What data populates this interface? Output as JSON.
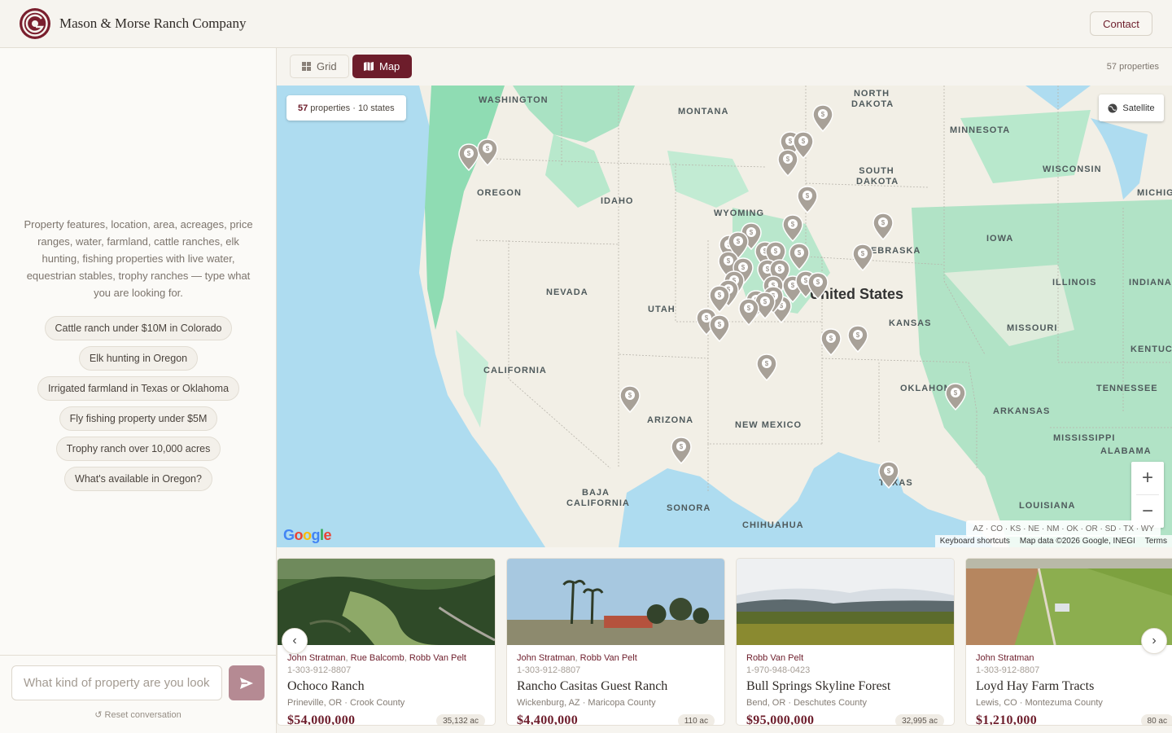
{
  "header": {
    "brand": "Mason & Morse Ranch Company",
    "contact_label": "Contact"
  },
  "sidebar": {
    "intro": "Property features, location, area, acreages, price ranges, water, farmland, cattle ranches, elk hunting, fishing properties with live water, equestrian stables, trophy ranches — type what you are looking for.",
    "suggestions": [
      "Cattle ranch under $10M in Colorado",
      "Elk hunting in Oregon",
      "Irrigated farmland in Texas or Oklahoma",
      "Fly fishing property under $5M",
      "Trophy ranch over 10,000 acres",
      "What's available in Oregon?"
    ],
    "chat_placeholder": "What kind of property are you looking for?",
    "reset_label": "↺ Reset conversation"
  },
  "toolbar": {
    "grid_label": "Grid",
    "map_label": "Map",
    "property_count": "57 properties"
  },
  "map": {
    "summary_count": "57",
    "summary_rest": "properties · 10 states",
    "satellite_label": "Satellite",
    "states_filter": "AZ · CO · KS · NE · NM · OK · OR · SD · TX · WY",
    "keyboard_shortcuts": "Keyboard shortcuts",
    "map_data": "Map data ©2026 Google, INEGI",
    "terms": "Terms",
    "google": "Google",
    "country_label": "United States",
    "state_labels": [
      "WASHINGTON",
      "MONTANA",
      "NORTH DAKOTA",
      "MINNESOTA",
      "OREGON",
      "IDAHO",
      "SOUTH DAKOTA",
      "WISCONSIN",
      "MICHIG",
      "WYOMING",
      "NEBRASKA",
      "IOWA",
      "NEVADA",
      "UTAH",
      "ILLINOIS",
      "INDIANA",
      "KANSAS",
      "MISSOURI",
      "KENTUCK",
      "CALIFORNIA",
      "OKLAHOMA",
      "TENNESSEE",
      "ARKANSAS",
      "ARIZONA",
      "NEW MEXICO",
      "MISSISSIPPI",
      "ALABAMA",
      "BAJA CALIFORNIA",
      "TEXAS",
      "LOUISIANA",
      "SONORA",
      "CHIHUAHUA"
    ]
  },
  "cards": [
    {
      "agents": [
        "John Stratman",
        "Rue Balcomb",
        "Robb Van Pelt"
      ],
      "phone": "1-303-912-8807",
      "title": "Ochoco Ranch",
      "location": "Prineville, OR · Crook County",
      "price": "$54,000,000",
      "acres": "35,132 ac"
    },
    {
      "agents": [
        "John Stratman",
        "Robb Van Pelt"
      ],
      "phone": "1-303-912-8807",
      "title": "Rancho Casitas Guest Ranch",
      "location": "Wickenburg, AZ · Maricopa County",
      "price": "$4,400,000",
      "acres": "110 ac"
    },
    {
      "agents": [
        "Robb Van Pelt"
      ],
      "phone": "1-970-948-0423",
      "title": "Bull Springs Skyline Forest",
      "location": "Bend, OR · Deschutes County",
      "price": "$95,000,000",
      "acres": "32,995 ac"
    },
    {
      "agents": [
        "John Stratman"
      ],
      "phone": "1-303-912-8807",
      "title": "Loyd Hay Farm Tracts",
      "location": "Lewis, CO · Montezuma County",
      "price": "$1,210,000",
      "acres": "80 ac"
    }
  ],
  "colors": {
    "accent": "#6d1d2b",
    "pin": "#a8a198",
    "water": "#aedcf0",
    "land": "#f2efe6",
    "green": "#8fdcb3"
  }
}
